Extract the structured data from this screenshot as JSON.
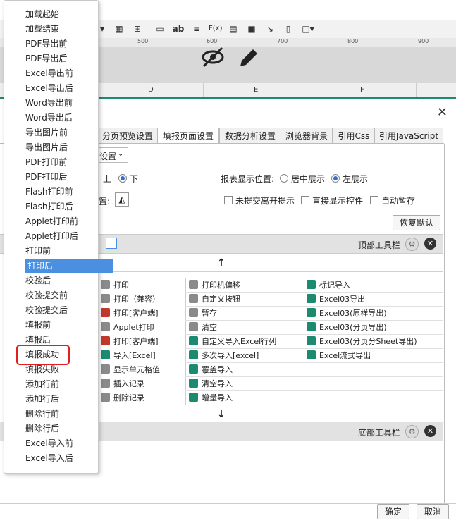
{
  "toolbar": {
    "icons": [
      "dropdown-arrow",
      "grid-icon",
      "table-icon",
      "barcode-icon",
      "text-ab-icon",
      "align-icon",
      "formula-icon",
      "chart-icon",
      "image-icon",
      "pen-icon",
      "mobile-icon",
      "border-icon"
    ],
    "ab_label": "ab",
    "fx_label": "F(x)"
  },
  "ruler": {
    "ticks": [
      "500",
      "600",
      "700",
      "800",
      "900"
    ]
  },
  "sheet": {
    "columns": [
      "D",
      "E",
      "F"
    ]
  },
  "dialog": {
    "close": "✕",
    "tabs": [
      "分页预览设置",
      "填报页面设置",
      "数据分析设置",
      "浏览器背景",
      "引用Css",
      "引用JavaScript"
    ],
    "active_tab": "填报页面设置",
    "partial_select": "设置",
    "radio_top": "上",
    "radio_bottom": "下",
    "report_position_label": "报表显示位置:",
    "position_center": "居中展示",
    "position_left": "左展示",
    "partial_bg_label": "置:",
    "check_unsubmitted": "未提交离开提示",
    "check_direct_control": "直接显示控件",
    "check_autosave": "自动暂存",
    "restore_default": "恢复默认",
    "top_toolbar_label": "顶部工具栏",
    "bottom_toolbar_label": "底部工具栏",
    "up_arrow": "↑",
    "down_arrow": "↓",
    "confirm": "确定",
    "cancel": "取消",
    "grid": [
      [
        "打印",
        "打印机偏移",
        "标记导入"
      ],
      [
        "打印（兼容）",
        "自定义按钮",
        "Excel03导出"
      ],
      [
        "打印[客户端]",
        "暂存",
        "Excel03(原样导出)"
      ],
      [
        "Applet打印",
        "清空",
        "Excel03(分页导出)"
      ],
      [
        "打印[客户端]",
        "自定义导入Excel行列",
        "Excel03(分页分Sheet导出)"
      ],
      [
        "导入[Excel]",
        "多次导入[excel]",
        "Excel流式导出"
      ],
      [
        "显示单元格值",
        "覆盖导入",
        ""
      ],
      [
        "插入记录",
        "清空导入",
        ""
      ],
      [
        "删除记录",
        "增量导入",
        ""
      ]
    ]
  },
  "menu": {
    "items": [
      "加载起始",
      "加载结束",
      "PDF导出前",
      "PDF导出后",
      "Excel导出前",
      "Excel导出后",
      "Word导出前",
      "Word导出后",
      "导出图片前",
      "导出图片后",
      "PDF打印前",
      "PDF打印后",
      "Flash打印前",
      "Flash打印后",
      "Applet打印前",
      "Applet打印后",
      "打印前",
      "打印后",
      "校验后",
      "校验提交前",
      "校验提交后",
      "填报前",
      "填报后",
      "填报成功",
      "填报失败",
      "添加行前",
      "添加行后",
      "删除行前",
      "删除行后",
      "Excel导入前",
      "Excel导入后"
    ],
    "selected": "打印后",
    "highlighted": "填报成功"
  },
  "colors": {
    "selected_bg": "#4a8fe0",
    "highlight_border": "#e02020",
    "excel_green": "#1c8a6e"
  }
}
